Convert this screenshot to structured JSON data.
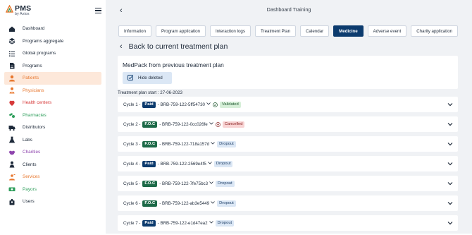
{
  "app": {
    "name": "PMS",
    "subtitle": "by Axios"
  },
  "sidebar": {
    "items": [
      {
        "label": "Dashboard",
        "icon": "home-icon",
        "color": "#1e2a3a",
        "active": false
      },
      {
        "label": "Programs aggregate",
        "icon": "layers-icon",
        "color": "#1e2a3a",
        "active": false
      },
      {
        "label": "Global programs",
        "icon": "list-icon",
        "color": "#1e2a3a",
        "active": false
      },
      {
        "label": "Programs",
        "icon": "document-icon",
        "color": "#1e2a3a",
        "active": false
      },
      {
        "label": "Patients",
        "icon": "person-icon",
        "color": "#e8772e",
        "active": true
      },
      {
        "label": "Physicians",
        "icon": "doctor-icon",
        "color": "#e8772e",
        "active": false
      },
      {
        "label": "Health centers",
        "icon": "heart-icon",
        "color": "#d63a3a",
        "active": false
      },
      {
        "label": "Pharmacies",
        "icon": "pills-icon",
        "color": "#2e9e5b",
        "active": false
      },
      {
        "label": "Distributors",
        "icon": "truck-icon",
        "color": "#1e2a3a",
        "active": false
      },
      {
        "label": "Labs",
        "icon": "flask-icon",
        "color": "#1e2a3a",
        "active": false
      },
      {
        "label": "Charities",
        "icon": "handshake-icon",
        "color": "#8e44ad",
        "active": false
      },
      {
        "label": "Clients",
        "icon": "client-icon",
        "color": "#1e2a3a",
        "active": false
      },
      {
        "label": "Services",
        "icon": "service-icon",
        "color": "#e8772e",
        "active": false
      },
      {
        "label": "Payors",
        "icon": "money-icon",
        "color": "#2e9e5b",
        "active": false
      },
      {
        "label": "Users",
        "icon": "users-icon",
        "color": "#1e2a3a",
        "active": false
      }
    ]
  },
  "header": {
    "title": "Dashboard Training"
  },
  "tabs": [
    {
      "label": "Information",
      "active": false
    },
    {
      "label": "Program application",
      "active": false
    },
    {
      "label": "Interaction logs",
      "active": false
    },
    {
      "label": "Treatment Plan",
      "active": false
    },
    {
      "label": "Calendar",
      "active": false
    },
    {
      "label": "Medicine",
      "active": true
    },
    {
      "label": "Adverse event",
      "active": false
    },
    {
      "label": "Charity application",
      "active": false
    }
  ],
  "back_link": "Back to current treatment plan",
  "medpack": {
    "title": "MedPack from previous treatment plan",
    "hide_button": "Hide deleted"
  },
  "plan_start": "Treatment plan start : 27-06-2023",
  "cycles": [
    {
      "prefix": "Cycle 1 -",
      "type": "Paid",
      "code": "- BRB-759-122-5ff54730",
      "status": "Validated",
      "status_kind": "validated"
    },
    {
      "prefix": "Cycle 2 -",
      "type": "F.O.C",
      "code": "- BRB-759-122-0cc026fe",
      "status": "Cancelled",
      "status_kind": "cancelled"
    },
    {
      "prefix": "Cycle 3 -",
      "type": "F.O.C",
      "code": "- BRB-759-122-718a157d",
      "status": "Dropout",
      "status_kind": "dropout"
    },
    {
      "prefix": "Cycle 4 -",
      "type": "Paid",
      "code": "- BRB-759-122-2569e4f5",
      "status": "Dropout",
      "status_kind": "dropout"
    },
    {
      "prefix": "Cycle 5 -",
      "type": "F.O.C",
      "code": "- BRB-759-122-7fe75bc3",
      "status": "Dropout",
      "status_kind": "dropout"
    },
    {
      "prefix": "Cycle 6 -",
      "type": "F.O.C",
      "code": "- BRB-759-122-ab3e5449",
      "status": "Dropout",
      "status_kind": "dropout"
    },
    {
      "prefix": "Cycle 7 -",
      "type": "Paid",
      "code": "- BRB-759-122-e1d47ea2",
      "status": "Dropout",
      "status_kind": "dropout"
    }
  ],
  "colors": {
    "primary": "#0c3b6e",
    "foc": "#1d6a48",
    "active_nav": "#fde8da",
    "background": "#f0f2f5"
  }
}
